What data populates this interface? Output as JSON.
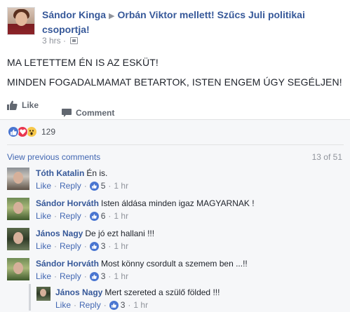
{
  "post": {
    "author": "Sándor Kinga",
    "group": "Orbán Viktor mellett! Szűcs Juli politikai csoportja!",
    "time": "3 hrs",
    "separator": "·",
    "lines": [
      "MA LETETTEM ÉN IS AZ ESKÜT!",
      "MINDEN FOGADALMAMAT BETARTOK, ISTEN ENGEM ÚGY SEGÉLJEN!"
    ]
  },
  "actions": {
    "like": "Like",
    "comment": "Comment"
  },
  "reactions": {
    "count": "129",
    "types": [
      "like-icon",
      "love-icon",
      "wow-icon"
    ]
  },
  "comments_nav": {
    "view_previous": "View previous comments",
    "counter": "13 of 51"
  },
  "comment_actions": {
    "like": "Like",
    "reply": "Reply",
    "dot": "·"
  },
  "comments": [
    {
      "name": "Tóth Katalin",
      "text": "Én is.",
      "likes": "5",
      "time": "1 hr"
    },
    {
      "name": "Sándor Horváth",
      "text": "Isten áldása minden igaz MAGYARNAK !",
      "likes": "6",
      "time": "1 hr"
    },
    {
      "name": "János Nagy",
      "text": "De jó ezt hallani !!!",
      "likes": "3",
      "time": "1 hr"
    },
    {
      "name": "Sándor Horváth",
      "text": "Most könny csordult a szemem ben ...!!",
      "likes": "3",
      "time": "1 hr"
    },
    {
      "name": "János Nagy",
      "text": "Mert szereted a szülő földed !!!",
      "likes": "3",
      "time": "1 hr"
    }
  ],
  "colors": {
    "link": "#365899",
    "accent": "#4267b2",
    "panel": "#f6f7f9",
    "muted": "#90949c"
  }
}
